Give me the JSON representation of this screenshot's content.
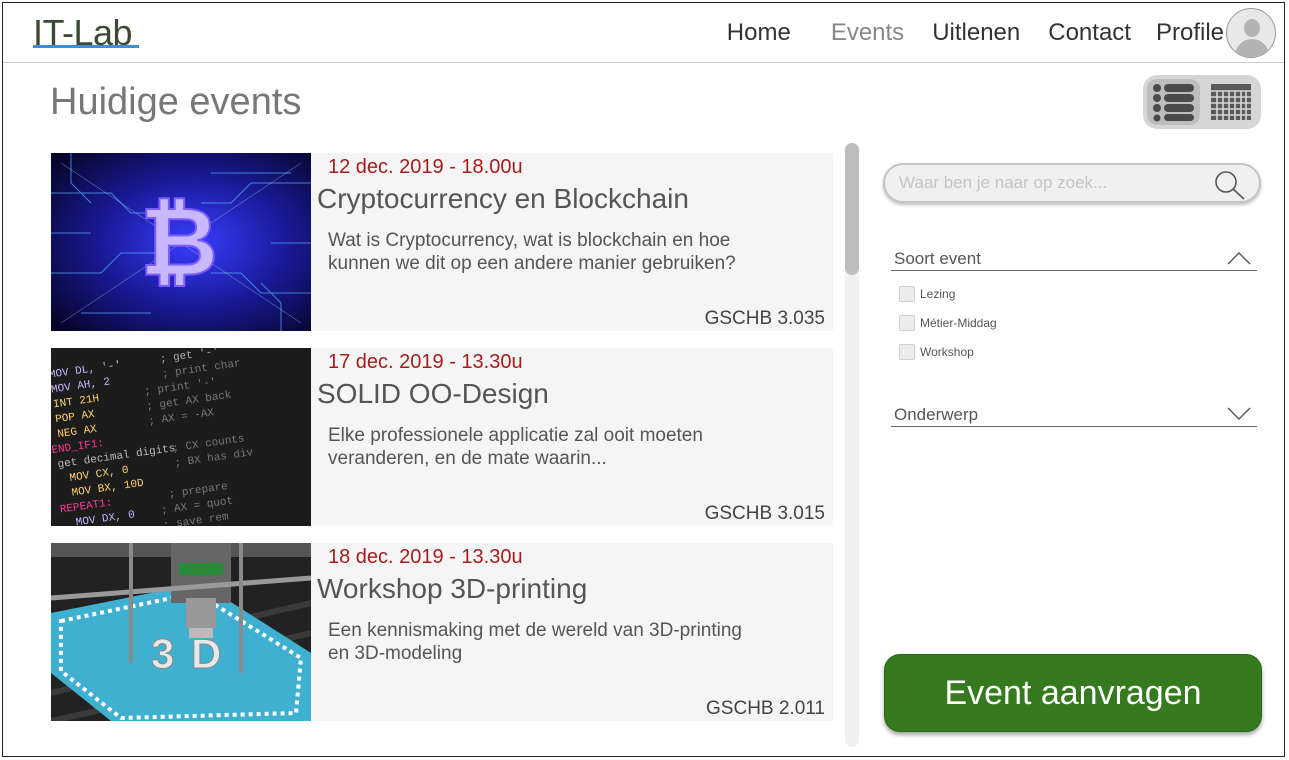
{
  "header": {
    "logo": "IT-Lab",
    "nav": [
      {
        "label": "Home",
        "active": false
      },
      {
        "label": "Events",
        "active": true
      },
      {
        "label": "Uitlenen",
        "active": false
      },
      {
        "label": "Contact",
        "active": false
      },
      {
        "label": "Profile",
        "active": false
      }
    ]
  },
  "main": {
    "title": "Huidige events",
    "view_toggle": {
      "active": "list",
      "options": [
        "list-icon",
        "grid-icon"
      ]
    }
  },
  "events": [
    {
      "date": "12 dec. 2019 - 18.00u",
      "title": "Cryptocurrency en Blockchain",
      "description": "Wat is Cryptocurrency, wat is blockchain en hoe kunnen we dit op een andere manier gebruiken?",
      "room": "GSCHB 3.035",
      "image": "bitcoin-circuit-image"
    },
    {
      "date": "17 dec. 2019 - 13.30u",
      "title": "SOLID OO-Design",
      "description": "Elke professionele applicatie zal ooit moeten veranderen, en de mate waarin...",
      "room": "GSCHB 3.015",
      "image": "assembly-code-image"
    },
    {
      "date": "18 dec. 2019 - 13.30u",
      "title": "Workshop 3D-printing",
      "description": "Een kennismaking met de wereld van 3D-printing en 3D-modeling",
      "room": "GSCHB 2.011",
      "image": "3d-printer-image"
    }
  ],
  "sidebar": {
    "search": {
      "placeholder": "Waar ben je naar op zoek...",
      "value": ""
    },
    "filters": [
      {
        "label": "Soort event",
        "expanded": true,
        "options": [
          "Lezing",
          "Métier-Middag",
          "Workshop"
        ]
      },
      {
        "label": "Onderwerp",
        "expanded": false,
        "options": []
      }
    ],
    "cta_label": "Event aanvragen"
  },
  "colors": {
    "accent_green": "#357a1f",
    "date_red": "#a61c1c",
    "logo_underline": "#3d8fd1"
  }
}
